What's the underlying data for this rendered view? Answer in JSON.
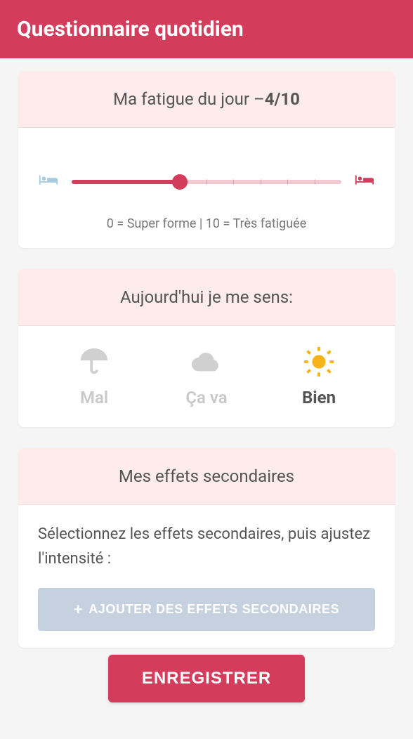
{
  "header": {
    "title": "Questionnaire quotidien"
  },
  "fatigue": {
    "title_prefix": "Ma fatigue du jour –",
    "value_display": "4/10",
    "value": 4,
    "max": 10,
    "hint": "0 = Super forme | 10 = Très fatiguée"
  },
  "mood": {
    "title": "Aujourd'hui je me sens:",
    "options": [
      {
        "id": "mal",
        "label": "Mal",
        "selected": false
      },
      {
        "id": "cava",
        "label": "Ça va",
        "selected": false
      },
      {
        "id": "bien",
        "label": "Bien",
        "selected": true
      }
    ]
  },
  "side_effects": {
    "title": "Mes effets secondaires",
    "instruction": "Sélectionnez les effets secondaires, puis ajustez l'intensité :",
    "add_label": "AJOUTER DES EFFETS SECONDAIRES"
  },
  "footer": {
    "save_label": "ENREGISTRER"
  },
  "colors": {
    "accent": "#d43c5c",
    "card_header_bg": "#fdeceb",
    "inactive": "#c9c9c9",
    "sun": "#f7b318",
    "add_btn": "#c6d1e0",
    "bed_left": "#a5cbe0",
    "bed_right": "#d43c5c"
  }
}
